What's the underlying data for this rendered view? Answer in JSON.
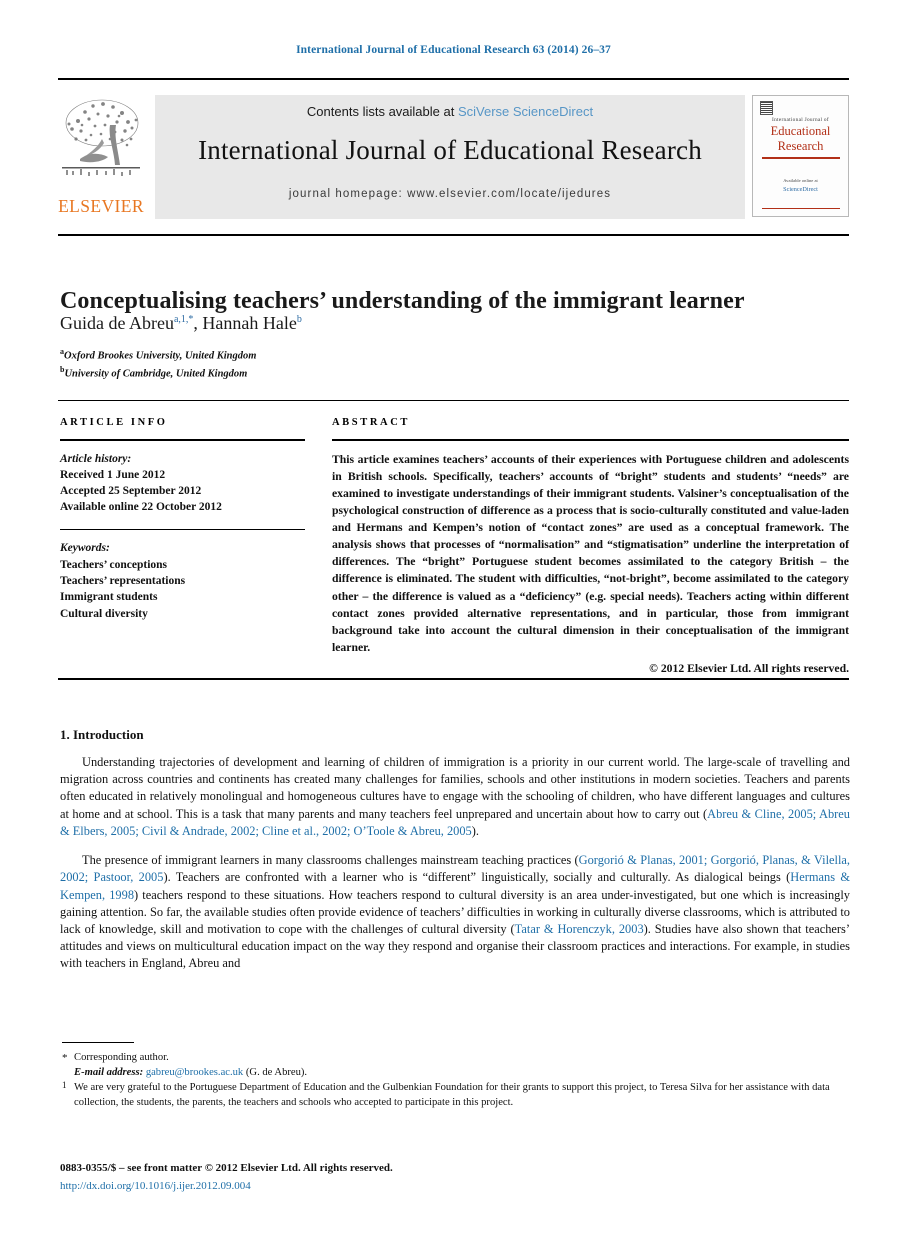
{
  "running_head": "International Journal of Educational Research 63 (2014) 26–37",
  "masthead": {
    "contents_prefix": "Contents lists available at ",
    "sciencedirect": "SciVerse ScienceDirect",
    "journal_title": "International Journal of Educational Research",
    "homepage": "journal homepage: www.elsevier.com/locate/ijedures",
    "publisher_name": "ELSEVIER",
    "cover": {
      "small_top": "International Journal of",
      "line1": "Educational",
      "line2": "Research",
      "availability": "Available online at",
      "platform": "ScienceDirect"
    }
  },
  "article": {
    "title": "Conceptualising teachers’ understanding of the immigrant learner",
    "authors": [
      {
        "name": "Guida de Abreu",
        "sup": "a,1,*"
      },
      {
        "name": "Hannah Hale",
        "sup": "b"
      }
    ],
    "authors_joiner": ", ",
    "affiliations": [
      {
        "marker": "a",
        "text": "Oxford Brookes University, United Kingdom"
      },
      {
        "marker": "b",
        "text": "University of Cambridge, United Kingdom"
      }
    ]
  },
  "info": {
    "label": "ARTICLE INFO",
    "history_label": "Article history:",
    "history": [
      "Received 1 June 2012",
      "Accepted 25 September 2012",
      "Available online 22 October 2012"
    ],
    "keywords_label": "Keywords:",
    "keywords": [
      "Teachers’ conceptions",
      "Teachers’ representations",
      "Immigrant students",
      "Cultural diversity"
    ]
  },
  "abstract": {
    "label": "ABSTRACT",
    "text": "This article examines teachers’ accounts of their experiences with Portuguese children and adolescents in British schools. Specifically, teachers’ accounts of “bright” students and students’ “needs” are examined to investigate understandings of their immigrant students. Valsiner’s conceptualisation of the psychological construction of difference as a process that is socio-culturally constituted and value-laden and Hermans and Kempen’s notion of “contact zones” are used as a conceptual framework. The analysis shows that processes of “normalisation” and “stigmatisation” underline the interpretation of differences. The “bright” Portuguese student becomes assimilated to the category British – the difference is eliminated. The student with difficulties, “not-bright”, become assimilated to the category other – the difference is valued as a “deficiency” (e.g. special needs). Teachers acting within different contact zones provided alternative representations, and in particular, those from immigrant background take into account the cultural dimension in their conceptualisation of the immigrant learner.",
    "copyright": "© 2012 Elsevier Ltd. All rights reserved."
  },
  "body": {
    "section_heading": "1. Introduction",
    "paragraphs": [
      {
        "parts": [
          {
            "type": "text",
            "value": "Understanding trajectories of development and learning of children of immigration is a priority in our current world. The large-scale of travelling and migration across countries and continents has created many challenges for families, schools and other institutions in modern societies. Teachers and parents often educated in relatively monolingual and homogeneous cultures have to engage with the schooling of children, who have different languages and cultures at home and at school. This is a task that many parents and many teachers feel unprepared and uncertain about how to carry out ("
          },
          {
            "type": "cite",
            "value": "Abreu & Cline, 2005; Abreu & Elbers, 2005; Civil & Andrade, 2002; Cline et al., 2002; O’Toole & Abreu, 2005"
          },
          {
            "type": "text",
            "value": ")."
          }
        ]
      },
      {
        "parts": [
          {
            "type": "text",
            "value": "The presence of immigrant learners in many classrooms challenges mainstream teaching practices ("
          },
          {
            "type": "cite",
            "value": "Gorgorió & Planas, 2001; Gorgorió, Planas, & Vilella, 2002; Pastoor, 2005"
          },
          {
            "type": "text",
            "value": "). Teachers are confronted with a learner who is “different” linguistically, socially and culturally. As dialogical beings ("
          },
          {
            "type": "cite",
            "value": "Hermans & Kempen, 1998"
          },
          {
            "type": "text",
            "value": ") teachers respond to these situations. How teachers respond to cultural diversity is an area under-investigated, but one which is increasingly gaining attention. So far, the available studies often provide evidence of teachers’ difficulties in working in culturally diverse classrooms, which is attributed to lack of knowledge, skill and motivation to cope with the challenges of cultural diversity ("
          },
          {
            "type": "cite",
            "value": "Tatar & Horenczyk, 2003"
          },
          {
            "type": "text",
            "value": "). Studies have also shown that teachers’ attitudes and views on multicultural education impact on the way they respond and organise their classroom practices and interactions. For example, in studies with teachers in England, Abreu and"
          }
        ]
      }
    ]
  },
  "footnotes": {
    "corresponding_marker": "*",
    "corresponding": "Corresponding author.",
    "email_label": "E-mail address:",
    "email": "gabreu@brookes.ac.uk",
    "email_owner": "(G. de Abreu).",
    "note_marker": "1",
    "note": "We are very grateful to the Portuguese Department of Education and the Gulbenkian Foundation for their grants to support this project, to Teresa Silva for her assistance with data collection, the students, the parents, the teachers and schools who accepted to participate in this project."
  },
  "footer": {
    "issn_line": "0883-0355/$ – see front matter © 2012 Elsevier Ltd. All rights reserved.",
    "doi": "http://dx.doi.org/10.1016/j.ijer.2012.09.004"
  },
  "colors": {
    "link_blue": "#1f6fa8",
    "sciencedirect_blue": "#5796c6",
    "elsevier_orange": "#E87722",
    "cover_red": "#b23018",
    "masthead_grey": "#e8e8e8"
  }
}
